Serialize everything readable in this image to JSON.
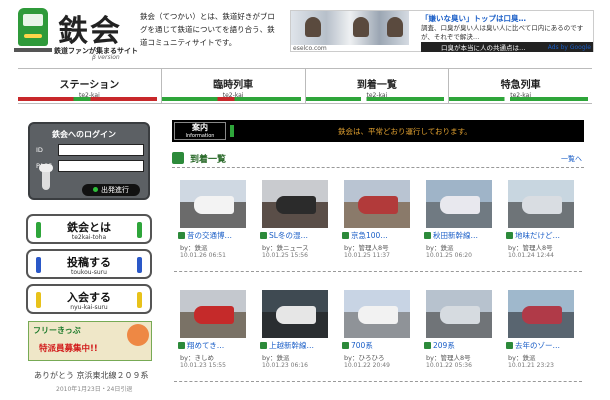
{
  "header": {
    "logo_title": "鉄会",
    "logo_subtitle": "鉄道ファンが集まるサイト",
    "logo_version": "β version",
    "intro": "鉄会（てつかい）とは、鉄道好きがブログを通じて鉄道についてを語り合う、鉄道コミュニティサイトです。"
  },
  "ad": {
    "headline": "「嫌いな臭い」トップは口臭…",
    "body": "調査、口臭が臭い人は臭い人に比べて口内にあるのですが、それぞで解決…",
    "strip": "口臭が本当に人の共通点は…",
    "caption": "eselco.com",
    "byline": "Ads by Google"
  },
  "nav": [
    {
      "label": "ステーション",
      "sub": "te2-kai",
      "color_a": "#c8282a",
      "color_b": "#2ea53a"
    },
    {
      "label": "臨時列車",
      "sub": "te2-kai",
      "color_a": "#2ea53a",
      "color_b": "#c8282a"
    },
    {
      "label": "到着一覧",
      "sub": "te2-kai",
      "color_a": "#2ea53a",
      "color_b": "#2ea53a"
    },
    {
      "label": "特急列車",
      "sub": "te2-kai",
      "color_a": "#2ea53a",
      "color_b": "#2ea53a"
    }
  ],
  "login": {
    "title": "鉄会へのログイン",
    "id_label": "ID",
    "pass_label": "PASS",
    "button": "出発進行"
  },
  "side_buttons": [
    {
      "label": "鉄会とは",
      "sub": "te2kai-toha",
      "color": "#2ea53a"
    },
    {
      "label": "投稿する",
      "sub": "toukou-suru",
      "color": "#2a58c8"
    },
    {
      "label": "入会する",
      "sub": "nyu-kai-suru",
      "color": "#e8c21a"
    }
  ],
  "banner": {
    "top": "フリーきっぷ",
    "bottom": "特派員募集中!!",
    "celebrate": "ありがとう 京浜東北線２０９系",
    "celebrate_sub": "2010年1月23日・24日引退"
  },
  "notice": {
    "tag": "案内",
    "tag_sub": "Information",
    "text": "鉄会は、平常どおり運行しております。"
  },
  "arrivals": {
    "title": "到着一覧",
    "more": "一覧へ",
    "items": [
      {
        "title": "昔の交通博…",
        "author": "by：鉄派",
        "time": "10.01.26 06:51",
        "sky": "#cfd8e2",
        "ground": "#6b6b6b",
        "train": "#f3f3f3"
      },
      {
        "title": "SL冬の湿…",
        "author": "by：鉄ニュース",
        "time": "10.01.25 15:56",
        "sky": "#c9cbcf",
        "ground": "#5a4e48",
        "train": "#2b2b2b"
      },
      {
        "title": "京急100…",
        "author": "by：管理人8号",
        "time": "10.01.25 11:37",
        "sky": "#b9c4d2",
        "ground": "#8a7a6a",
        "train": "#b23a3a"
      },
      {
        "title": "秋田新幹線…",
        "author": "by：鉄派",
        "time": "10.01.25 06:20",
        "sky": "#9fb4c8",
        "ground": "#707a82",
        "train": "#e8e8ee"
      },
      {
        "title": "地味だけど…",
        "author": "by：管理人8号",
        "time": "10.01.24 12:44",
        "sky": "#c8d6e0",
        "ground": "#6e7478",
        "train": "#d9dde2"
      },
      {
        "title": "翔めてき…",
        "author": "by：きしめ",
        "time": "10.01.23 15:55",
        "sky": "#c4c8ce",
        "ground": "#7a7266",
        "train": "#c52a2a"
      },
      {
        "title": "上越新幹線…",
        "author": "by：鉄派",
        "time": "10.01.23 06:16",
        "sky": "#3f4a52",
        "ground": "#2a2e31",
        "train": "#e6e6e6"
      },
      {
        "title": "700系",
        "author": "by：ひろひろ",
        "time": "10.01.22 20:49",
        "sky": "#c8d4e4",
        "ground": "#8f9398",
        "train": "#f2f2f2"
      },
      {
        "title": "209系",
        "author": "by：管理人8号",
        "time": "10.01.22 05:36",
        "sky": "#b7c2ce",
        "ground": "#707478",
        "train": "#d6dbe0"
      },
      {
        "title": "去年のゾー…",
        "author": "by：鉄派",
        "time": "10.01.21 23:23",
        "sky": "#9fb8cc",
        "ground": "#596570",
        "train": "#b03a48"
      }
    ]
  }
}
